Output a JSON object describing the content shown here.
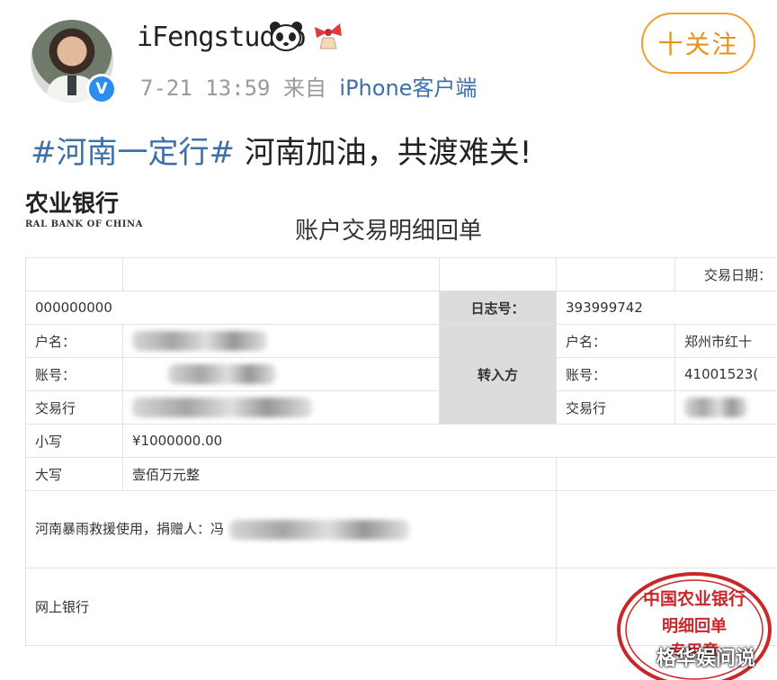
{
  "post": {
    "username": "iFengstudio",
    "verified_badge": "V",
    "time": "7-21 13:59",
    "source_prefix": "来自",
    "source": "iPhone客户端",
    "follow_label": "十关注",
    "hashtag": "#河南一定行#",
    "text": " 河南加油，共渡难关!",
    "icons": {
      "emoji_1": "panda-icon",
      "emoji_2": "ribbon-bell-icon"
    }
  },
  "receipt": {
    "bank_name_cn": "农业银行",
    "bank_name_en": "RAL BANK OF CHINA",
    "title": "账户交易明细回单",
    "txn_date_label": "交易日期：",
    "account_row_value": "000000000",
    "log_no_label": "日志号：",
    "log_no_value": "393999742",
    "payer": {
      "name_label": "户名：",
      "account_label": "账号：",
      "bank_label": "交易行"
    },
    "payee_label": "转入方",
    "payee": {
      "name_label": "户名：",
      "name_value": "郑州市红十",
      "account_label": "账号：",
      "account_value": "41001523(",
      "bank_label": "交易行"
    },
    "amount_small_label": "小写",
    "amount_small_value": "¥1000000.00",
    "amount_big_label": "大写",
    "amount_big_value": "壹佰万元整",
    "memo": "河南暴雨救援使用，捐赠人：冯",
    "channel": "网上银行",
    "seal_lines": [
      "中国农业银行",
      "明细回单",
      "专用章"
    ]
  },
  "watermark": "格华娱问说",
  "colors": {
    "link": "#3d6fa8",
    "follow": "#e8921c",
    "seal": "#c8282a"
  }
}
